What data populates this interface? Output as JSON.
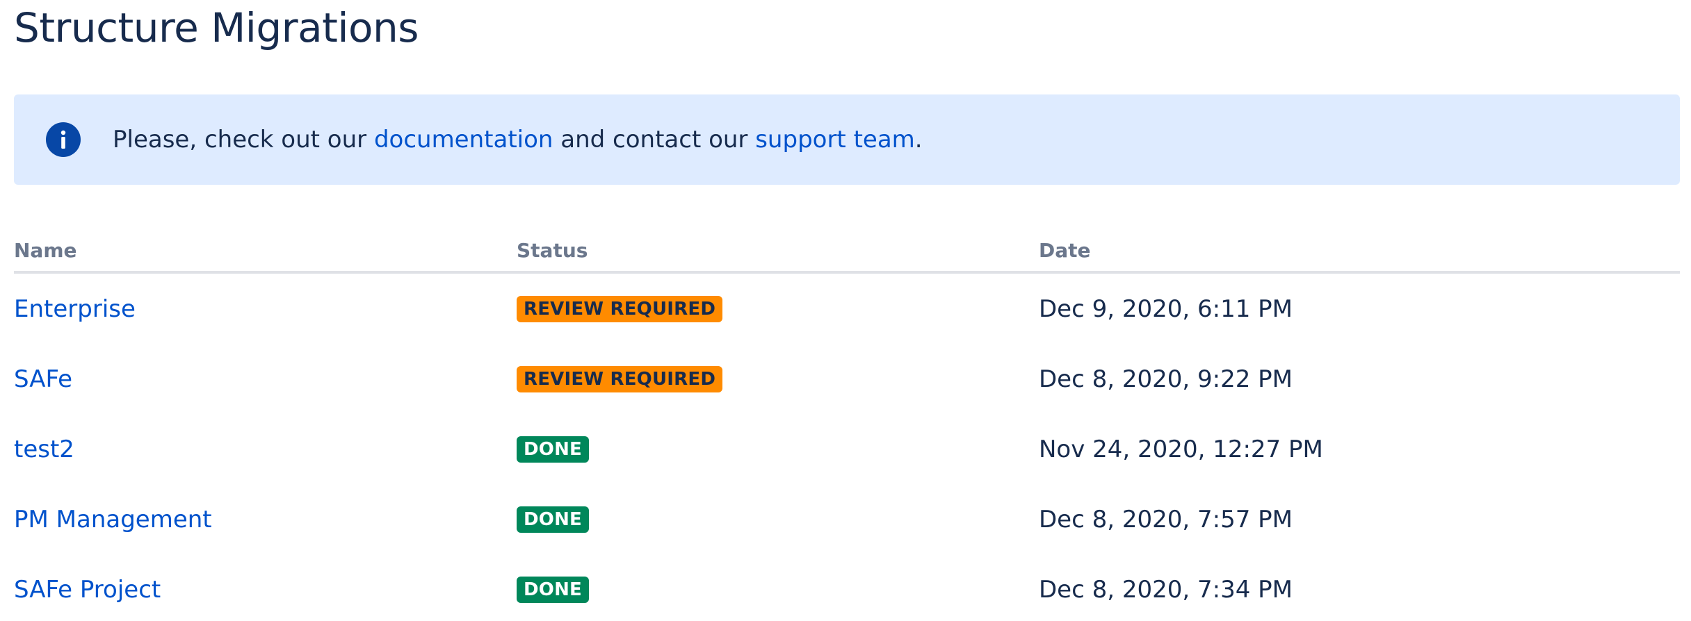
{
  "page": {
    "title": "Structure Migrations"
  },
  "info": {
    "text_before": "Please, check out our ",
    "link_documentation": "documentation",
    "text_middle": " and contact our ",
    "link_support": "support team",
    "text_after": ".",
    "icon": "info-icon"
  },
  "table": {
    "headers": {
      "name": "Name",
      "status": "Status",
      "date": "Date"
    },
    "rows": [
      {
        "name": "Enterprise",
        "status": "REVIEW REQUIRED",
        "date": "Dec 9, 2020, 6:11 PM"
      },
      {
        "name": "SAFe",
        "status": "REVIEW REQUIRED",
        "date": "Dec 8, 2020, 9:22 PM"
      },
      {
        "name": "test2",
        "status": "DONE",
        "date": "Nov 24, 2020, 12:27 PM"
      },
      {
        "name": "PM Management",
        "status": "DONE",
        "date": "Dec 8, 2020, 7:57 PM"
      },
      {
        "name": "SAFe Project",
        "status": "DONE",
        "date": "Dec 8, 2020, 7:34 PM"
      }
    ]
  },
  "colors": {
    "info_background": "#deebff",
    "info_icon": "#0747a6",
    "link": "#0052cc",
    "review_required": "#ff8b00",
    "done": "#00875a"
  }
}
